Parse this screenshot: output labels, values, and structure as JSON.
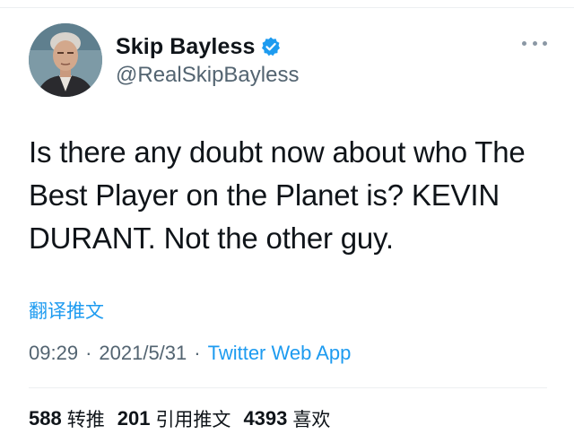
{
  "user": {
    "display_name": "Skip Bayless",
    "handle": "@RealSkipBayless",
    "verified": true
  },
  "tweet": {
    "text": "Is there any doubt now about who The Best Player on the Planet is? KEVIN DURANT. Not the other guy.",
    "translate_label": "翻译推文",
    "time": "09:29",
    "date": "2021/5/31",
    "separator": "·",
    "source": "Twitter Web App"
  },
  "stats": {
    "retweets": "588",
    "retweets_label": "转推",
    "quotes": "201",
    "quotes_label": "引用推文",
    "likes": "4393",
    "likes_label": "喜欢"
  },
  "colors": {
    "link": "#1d9bf0",
    "secondary_text": "#536471",
    "primary_text": "#0f1419"
  },
  "icons": {
    "verified": "verified-badge-icon",
    "more": "more-options-icon"
  }
}
